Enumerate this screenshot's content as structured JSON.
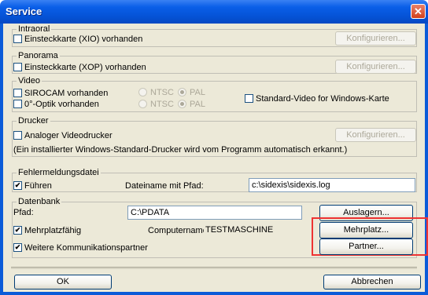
{
  "window": {
    "title": "Service",
    "close_glyph": "✕"
  },
  "intraoral": {
    "label": "Intraoral",
    "checkbox_label": "Einsteckkarte (XIO) vorhanden",
    "checked": false,
    "button": "Konfigurieren..."
  },
  "panorama": {
    "label": "Panorama",
    "checkbox_label": "Einsteckkarte (XOP) vorhanden",
    "checked": false,
    "button": "Konfigurieren..."
  },
  "video": {
    "label": "Video",
    "sirocam_label": "SIROCAM vorhanden",
    "optik_label": "0°-Optik vorhanden",
    "ntsc": "NTSC",
    "pal": "PAL",
    "standard_label": "Standard-Video for Windows-Karte"
  },
  "drucker": {
    "label": "Drucker",
    "checkbox_label": "Analoger Videodrucker",
    "button": "Konfigurieren...",
    "note": "(Ein installierter Windows-Standard-Drucker wird vom Programm automatisch erkannt.)"
  },
  "fehler": {
    "label": "Fehlermeldungsdatei",
    "fuhren_label": "Führen",
    "fuhren_checked": true,
    "path_label": "Dateiname mit Pfad:",
    "path_value": "c:\\sidexis\\sidexis.log"
  },
  "datenbank": {
    "label": "Datenbank",
    "pfad_label": "Pfad:",
    "pfad_value": "C:\\PDATA",
    "auslagern_button": "Auslagern...",
    "mehrplatz_label": "Mehrplatzfähig",
    "mehrplatz_checked": true,
    "computername_label": "Computername:",
    "computername_value": "TESTMASCHINE",
    "mehrplatz_button": "Mehrplatz...",
    "weitere_label": "Weitere Kommunikationspartner",
    "weitere_checked": true,
    "partner_button": "Partner..."
  },
  "footer": {
    "ok": "OK",
    "cancel": "Abbrechen"
  },
  "colors": {
    "highlight": "#ee3333",
    "title_blue": "#0553d6"
  }
}
